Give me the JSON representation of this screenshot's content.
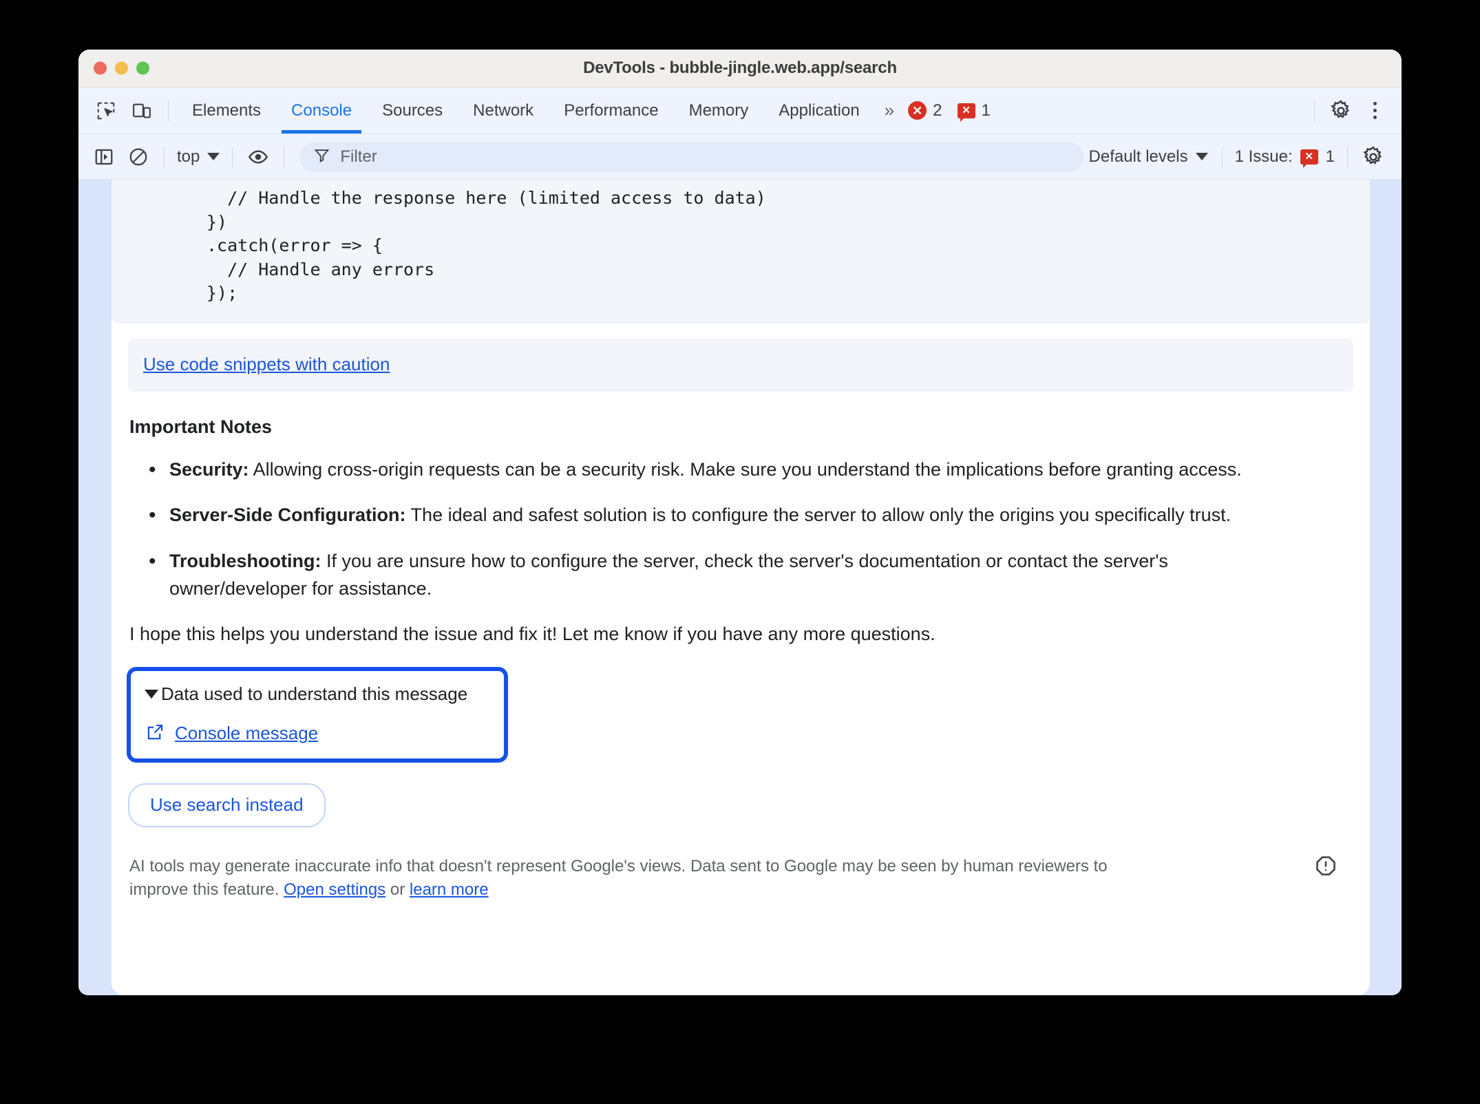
{
  "window": {
    "title": "DevTools - bubble-jingle.web.app/search",
    "traffic_lights": [
      "close-button",
      "minimize-button",
      "maximize-button"
    ],
    "colors": {
      "close": "#ed6a5e",
      "minimize": "#f5bd4f",
      "maximize": "#61c454"
    }
  },
  "tabbar": {
    "inspect_icon": "inspect-element-icon",
    "device_icon": "device-toolbar-icon",
    "tabs": [
      {
        "label": "Elements",
        "active": false
      },
      {
        "label": "Console",
        "active": true
      },
      {
        "label": "Sources",
        "active": false
      },
      {
        "label": "Network",
        "active": false
      },
      {
        "label": "Performance",
        "active": false
      },
      {
        "label": "Memory",
        "active": false
      },
      {
        "label": "Application",
        "active": false
      }
    ],
    "more_tabs": "»",
    "error_badge": {
      "icon": "error-circle-icon",
      "count": "2"
    },
    "issue_badge": {
      "icon": "issue-bubble-icon",
      "count": "1"
    },
    "settings_icon": "gear-icon",
    "more_icon": "kebab-menu-icon",
    "accent": "#1a73e8"
  },
  "console_toolbar": {
    "sidebar_icon": "console-sidebar-icon",
    "clear_icon": "clear-console-icon",
    "context": "top",
    "eye_icon": "live-expression-eye-icon",
    "filter": {
      "icon": "filter-icon",
      "placeholder": "Filter",
      "value": ""
    },
    "levels": "Default levels",
    "issues_label": "1 Issue:",
    "issues_count": "1",
    "settings_icon": "console-settings-gear-icon"
  },
  "message": {
    "code": "  // Handle the response here (limited access to data)\n})\n.catch(error => {\n  // Handle any errors\n});",
    "snippet_warning_link": "Use code snippets with caution",
    "section_title": "Important Notes",
    "notes": [
      {
        "term": "Security:",
        "text": " Allowing cross-origin requests can be a security risk. Make sure you understand the implications before granting access."
      },
      {
        "term": "Server-Side Configuration:",
        "text": " The ideal and safest solution is to configure the server to allow only the origins you specifically trust."
      },
      {
        "term": "Troubleshooting:",
        "text": " If you are unsure how to configure the server, check the server's documentation or contact the server's owner/developer for assistance."
      }
    ],
    "closing": "I hope this helps you understand the issue and fix it! Let me know if you have any more questions.",
    "data_box": {
      "summary": "Data used to understand this message",
      "expanded": true,
      "disclosure_icon": "triangle-down-icon",
      "item_icon": "external-link-icon",
      "item_label": "Console message",
      "focus_ring_color": "#1650e8"
    },
    "use_search_button": "Use search instead"
  },
  "footer": {
    "text_before": "AI tools may generate inaccurate info that doesn't represent Google's views. Data sent to Google may be seen by human reviewers to improve this feature. ",
    "link_settings": "Open settings",
    "text_middle": " or ",
    "link_learn": "learn more",
    "report_icon": "report-warning-icon"
  }
}
